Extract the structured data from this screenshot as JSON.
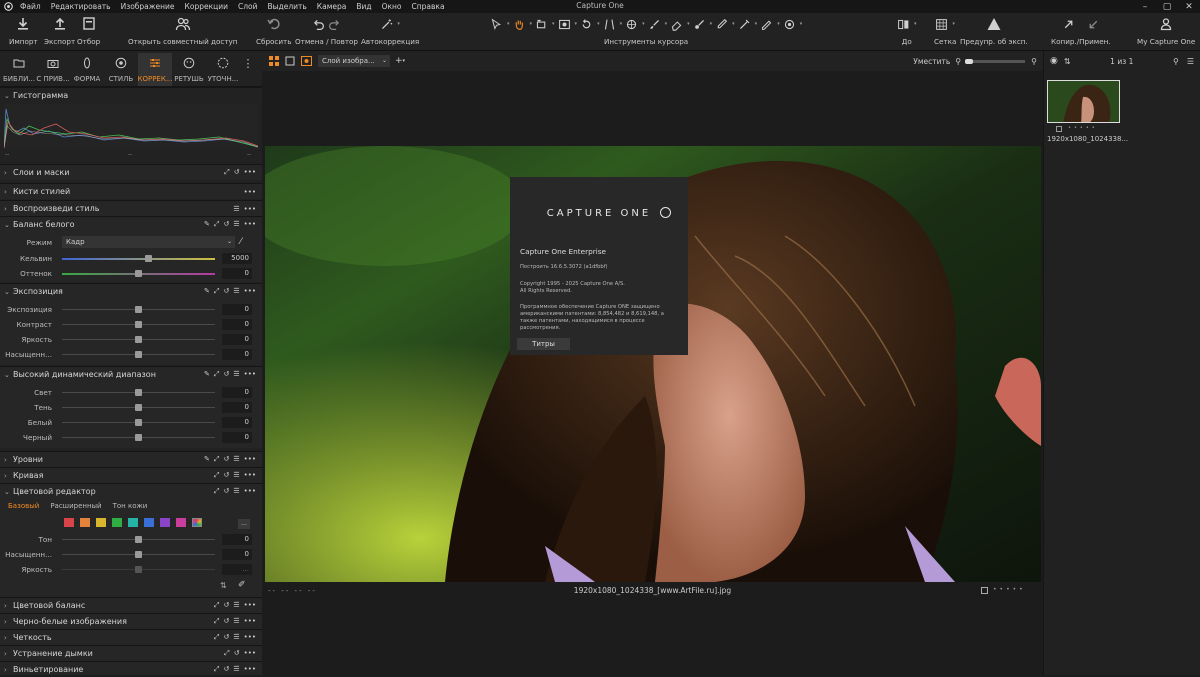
{
  "menubar": {
    "app_title": "Capture One",
    "items": [
      "Файл",
      "Редактировать",
      "Изображение",
      "Коррекции",
      "Слой",
      "Выделить",
      "Камера",
      "Вид",
      "Окно",
      "Справка"
    ]
  },
  "toolbar": {
    "import": "Импорт",
    "export": "Экспорт",
    "select": "Отбор",
    "share": "Открыть совместный доступ",
    "reset": "Сбросить",
    "undo_redo": "Отмена / Повтор",
    "autocorrect": "Автокоррекция",
    "cursor_tools": "Инструменты курсора",
    "before": "До",
    "grid": "Сетка",
    "exposure_warning": "Предупр. об эксп.",
    "copy_apply": "Копир./Примен.",
    "account": "My Capture One"
  },
  "tooltabs": [
    "БИБЛИ...",
    "С ПРИВ...",
    "ФОРМА",
    "СТИЛЬ",
    "КОРРЕК...",
    "РЕТУШЬ",
    "УТОЧН..."
  ],
  "left": {
    "histogram": "Гистограмма",
    "hist_labels": [
      "--",
      "--",
      "--"
    ],
    "layers": "Слои и маски",
    "style_brushes": "Кисти стилей",
    "style_repro": "Воспроизведи стиль",
    "wb": {
      "title": "Баланс белого",
      "mode_label": "Режим",
      "mode_value": "Кадр",
      "kelvin_label": "Кельвин",
      "kelvin_value": "5000",
      "tint_label": "Оттенок",
      "tint_value": "0"
    },
    "exposure": {
      "title": "Экспозиция",
      "rows": [
        {
          "label": "Экспозиция",
          "value": "0"
        },
        {
          "label": "Контраст",
          "value": "0"
        },
        {
          "label": "Яркость",
          "value": "0"
        },
        {
          "label": "Насыщенн...",
          "value": "0"
        }
      ]
    },
    "hdr": {
      "title": "Высокий динамический диапазон",
      "rows": [
        {
          "label": "Свет",
          "value": "0"
        },
        {
          "label": "Тень",
          "value": "0"
        },
        {
          "label": "Белый",
          "value": "0"
        },
        {
          "label": "Черный",
          "value": "0"
        }
      ]
    },
    "levels": "Уровни",
    "curve": "Кривая",
    "color_editor": {
      "title": "Цветовой редактор",
      "tabs": [
        "Базовый",
        "Расширенный",
        "Тон кожи"
      ],
      "rows": [
        {
          "label": "Тон",
          "value": "0"
        },
        {
          "label": "Насыщенн...",
          "value": "0"
        },
        {
          "label": "Яркость",
          "value": "..."
        }
      ],
      "swatches": [
        "#d9434a",
        "#e4843a",
        "#d9b52d",
        "#2fae43",
        "#25b3a8",
        "#3a6fd8",
        "#8a44c9",
        "#c93d9d"
      ]
    },
    "bottom_sections": [
      "Цветовой баланс",
      "Черно-белые изображения",
      "Четкость",
      "Устранение дымки",
      "Виньетирование"
    ]
  },
  "viewer": {
    "layer_select": "Слой изобра...",
    "fit": "Уместить",
    "filename": "1920x1080_1024338_[www.ArtFile.ru].jpg",
    "rating_left": "-- -- -- --"
  },
  "about": {
    "brand": "CAPTURE ONE",
    "product": "Capture One Enterprise",
    "build": "Построить 16.6.5.3072 (a1dfbbf)",
    "copyright1": "Copyright 1995 - 2025 Capture One A/S.",
    "copyright2": "All Rights Reserved.",
    "patents": "Программное обеспечение Capture ONE защищено американскими патентами: 8,854,482 и 8,619,148, а также патентами, находящимися в процессе рассмотрения.",
    "credits": "Титры"
  },
  "right": {
    "counter": "1 из 1",
    "thumb_name": "1920x1080_1024338..."
  },
  "colors": {
    "accent": "#f08a24",
    "panel": "#222222",
    "viewer": "#1c1c1c"
  }
}
